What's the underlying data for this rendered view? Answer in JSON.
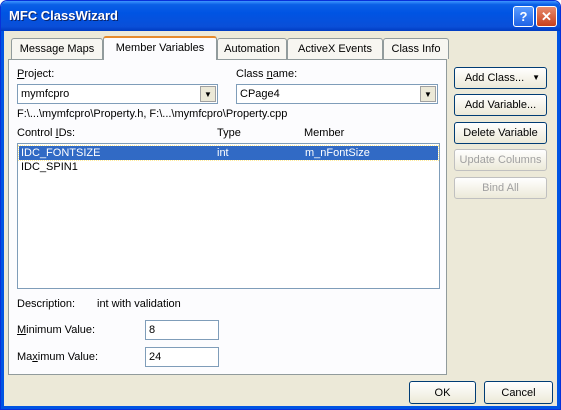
{
  "window": {
    "title": "MFC ClassWizard",
    "help_label": "?",
    "close_label": "✕"
  },
  "tabs": [
    {
      "label": "Message Maps",
      "active": false
    },
    {
      "label": "Member Variables",
      "active": true
    },
    {
      "label": "Automation",
      "active": false
    },
    {
      "label": "ActiveX Events",
      "active": false
    },
    {
      "label": "Class Info",
      "active": false
    }
  ],
  "project": {
    "label": "Project:",
    "value": "mymfcpro"
  },
  "class_name": {
    "label_pre": "Class ",
    "label_u": "n",
    "label_post": "ame:",
    "value": "CPage4"
  },
  "file_path": "F:\\...\\mymfcpro\\Property.h, F:\\...\\mymfcpro\\Property.cpp",
  "list": {
    "headers": {
      "ids": "Control IDs:",
      "type": "Type",
      "member": "Member"
    },
    "rows": [
      {
        "id": "IDC_FONTSIZE",
        "type": "int",
        "member": "m_nFontSize",
        "selected": true
      },
      {
        "id": "IDC_SPIN1",
        "type": "",
        "member": "",
        "selected": false
      }
    ]
  },
  "description": {
    "label": "Description:",
    "value": "int with validation"
  },
  "min_value": {
    "label_u": "M",
    "label_post": "inimum Value:",
    "value": "8"
  },
  "max_value": {
    "label_pre": "Ma",
    "label_u": "x",
    "label_post": "imum Value:",
    "value": "24"
  },
  "buttons": {
    "add_class": "Add Class...",
    "add_variable": "Add Variable...",
    "delete_variable": "Delete Variable",
    "update_columns": "Update Columns",
    "bind_all": "Bind All",
    "ok": "OK",
    "cancel": "Cancel"
  }
}
